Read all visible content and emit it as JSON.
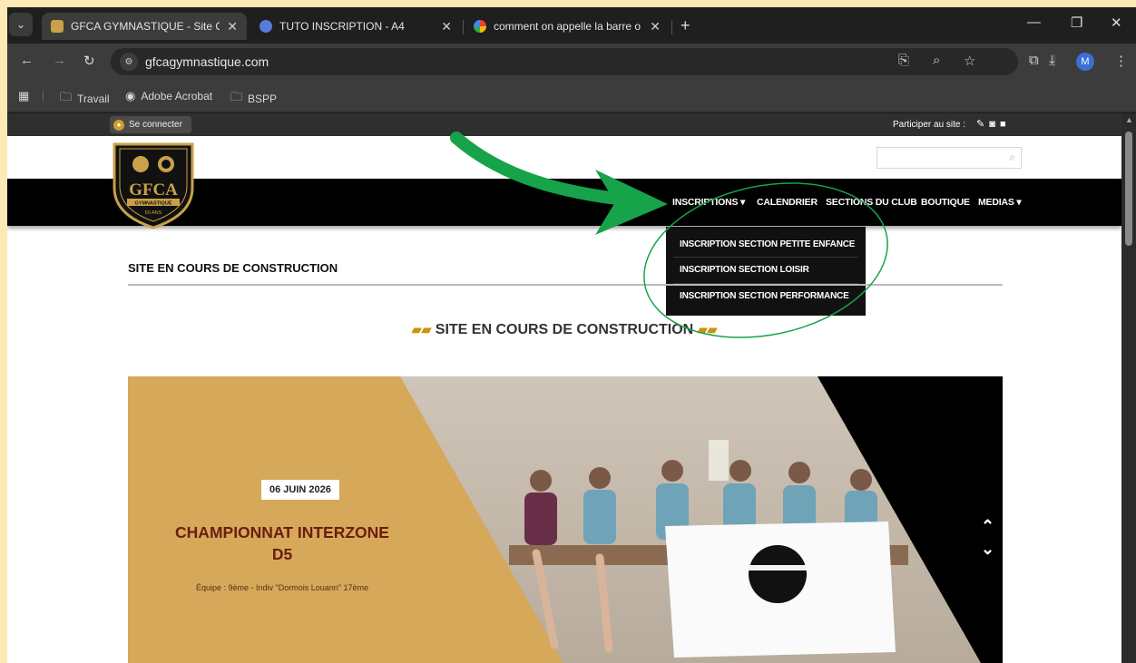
{
  "browser": {
    "tabs": [
      {
        "title": "GFCA GYMNASTIQUE - Site Offi",
        "active": true
      },
      {
        "title": "TUTO INSCRIPTION - A4",
        "active": false
      },
      {
        "title": "comment on appelle la barre o",
        "active": false
      }
    ],
    "url": "gfcagymnastique.com",
    "bookmarks": [
      "Travail",
      "Adobe Acrobat",
      "BSPP"
    ],
    "avatar_letter": "M"
  },
  "site": {
    "connect_label": "Se connecter",
    "participer_label": "Participer au site :",
    "nav": [
      "INSCRIPTIONS",
      "CALENDRIER",
      "SECTIONS DU CLUB",
      "BOUTIQUE",
      "MEDIAS"
    ],
    "dropdown": [
      "INSCRIPTION SECTION PETITE ENFANCE",
      "INSCRIPTION SECTION LOISIR",
      "INSCRIPTION SECTION PERFORMANCE"
    ],
    "heading": "SITE EN COURS DE CONSTRUCTION",
    "center_title": "SITE EN COURS DE CONSTRUCTION",
    "logo": {
      "initials": "GFCA",
      "ribbon": "GYMNASTIQUE",
      "years": "50 ANS"
    },
    "slide": {
      "date": "06 JUIN 2026",
      "title_line1": "CHAMPIONNAT INTERZONE",
      "title_line2": "D5",
      "subtitle": "Équipe : 9ème - Indiv \"Dormois Louann\" 17ème"
    }
  },
  "colors": {
    "page_bg": "#fbe9b6",
    "navbar": "#000000",
    "slide_gold": "#d6a85a",
    "event_title": "#6b1d0f",
    "annotation_green": "#16a34a"
  }
}
